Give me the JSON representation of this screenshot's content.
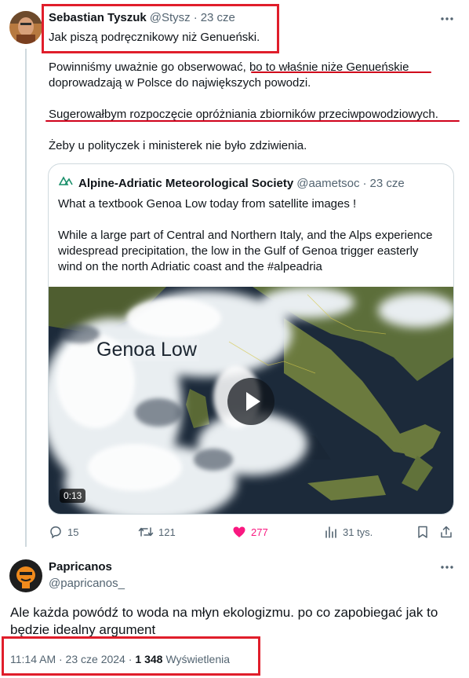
{
  "tweet1": {
    "author_name": "Sebastian Tyszuk",
    "handle": "@Stysz",
    "separator": "·",
    "date": "23 cze",
    "more_icon": "more-horizontal-icon",
    "line1": "Jak piszą podręcznikowy niż Genueński.",
    "para1a": "Powinniśmy uważnie go obserwować, bo to właśnie niże Genueńskie",
    "para1b": "doprowadzają w Polsce do największych powodzi.",
    "para2": "Sugerowałbym rozpoczęcie opróżniania zbiorników przeciwpowodziowych.",
    "para3": "Żeby u polityczek i ministerek nie było zdziwienia."
  },
  "quoted": {
    "org_name": "Alpine-Adriatic Meteorological Society",
    "handle": "@aametsoc",
    "separator": "·",
    "date": "23 cze",
    "line1": "What a textbook Genoa Low today from satellite images !",
    "para_a": "While a large part of Central and Northern Italy, and the Alps experience",
    "para_b": "widespread precipitation, the low in the Gulf of Genoa trigger easterly",
    "para_c": "wind on the north Adriatic coast and the #alpeadria",
    "video_label": "Genoa Low",
    "video_duration": "0:13"
  },
  "actions": {
    "replies": "15",
    "retweets": "121",
    "likes": "277",
    "views": "31 tys.",
    "like_color": "#f91880"
  },
  "tweet2": {
    "author_name": "Papricanos",
    "handle": "@papricanos_",
    "more_icon": "more-horizontal-icon",
    "line1": "Ale każda powódź to woda na młyn ekologizmu. po co zapobiegać jak to",
    "line2": "będzie idealny argument",
    "timestamp": "11:14 AM · 23 cze 2024 ·",
    "views_count": "1 348",
    "views_label": "Wyświetlenia"
  },
  "colors": {
    "highlight": "#e01e2b",
    "text": "#0f1419",
    "muted": "#536471",
    "border": "#cfd9de"
  }
}
